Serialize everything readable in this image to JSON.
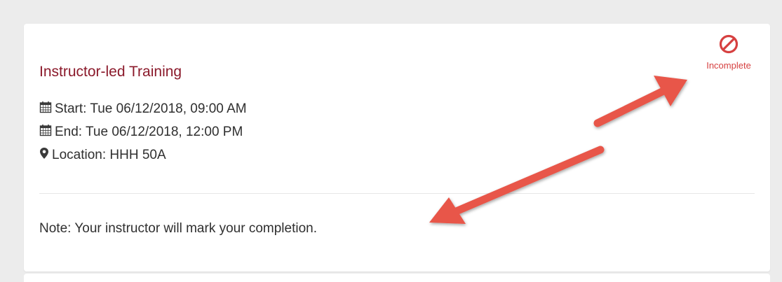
{
  "card": {
    "title": "Instructor-led Training",
    "start_label": "Start: Tue 06/12/2018, 09:00 AM",
    "end_label": "End: Tue 06/12/2018, 12:00 PM",
    "location_label": "Location: HHH 50A",
    "note": "Note: Your instructor will mark your completion.",
    "status": {
      "label": "Incomplete",
      "icon": "prohibited-icon"
    }
  },
  "annotations": {
    "arrow_color": "#e8574a",
    "count": 2
  },
  "colors": {
    "title": "#8b1a2b",
    "status": "#d64040",
    "text": "#2f2f2f",
    "background": "#ececec"
  }
}
